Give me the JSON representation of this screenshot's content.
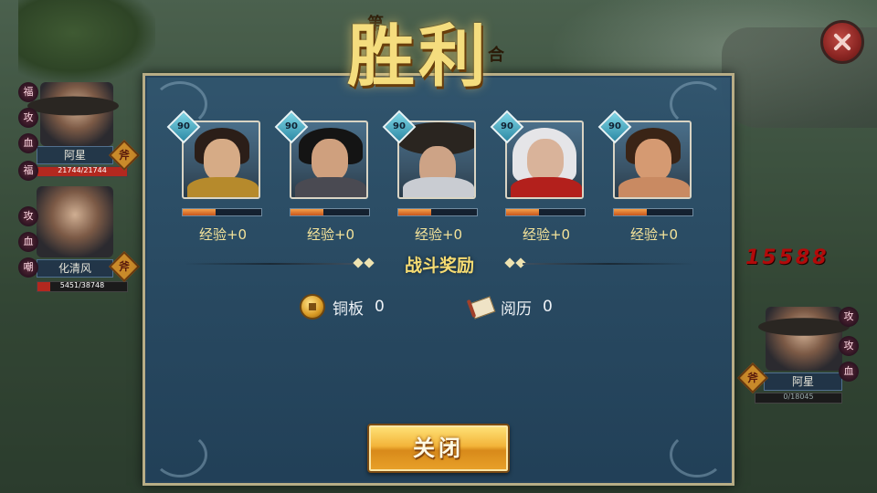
{
  "title": "胜利",
  "title_overlay": [
    "第",
    "合"
  ],
  "left_units": [
    {
      "name": "阿星",
      "hp_text": "21744/21744",
      "hp_fraction": 1.0,
      "badge": "斧",
      "statuses": [
        "福",
        "攻",
        "血",
        "福"
      ]
    },
    {
      "name": "化清风",
      "hp_text": "5451/38748",
      "hp_fraction": 0.14,
      "badge": "斧",
      "statuses": [
        "攻",
        "血",
        "嘲"
      ]
    }
  ],
  "right_unit": {
    "name": "阿星",
    "hp_text": "0/18045",
    "hp_fraction": 0.0,
    "badge": "斧",
    "statuses": [
      "攻",
      "攻",
      "血"
    ]
  },
  "damage_number": "15588",
  "heroes": [
    {
      "level": "90",
      "xp_label": "经验+0",
      "xp_fraction": 0.42,
      "palette": "warrior"
    },
    {
      "level": "90",
      "xp_label": "经验+0",
      "xp_fraction": 0.42,
      "palette": "dark"
    },
    {
      "level": "90",
      "xp_label": "经验+0",
      "xp_fraction": 0.42,
      "palette": "hat"
    },
    {
      "level": "90",
      "xp_label": "经验+0",
      "xp_fraction": 0.42,
      "palette": "elder"
    },
    {
      "level": "90",
      "xp_label": "经验+0",
      "xp_fraction": 0.42,
      "palette": "brawler"
    }
  ],
  "rewards_title": "战斗奖励",
  "rewards": [
    {
      "icon": "copper-coin-icon",
      "label": "铜板",
      "value": "0"
    },
    {
      "icon": "experience-scroll-icon",
      "label": "阅历",
      "value": "0"
    }
  ],
  "close_button_label": "关闭",
  "colors": {
    "gold": "#f6dc72",
    "panel": "#2f5470",
    "xp": "#e07a2a"
  }
}
